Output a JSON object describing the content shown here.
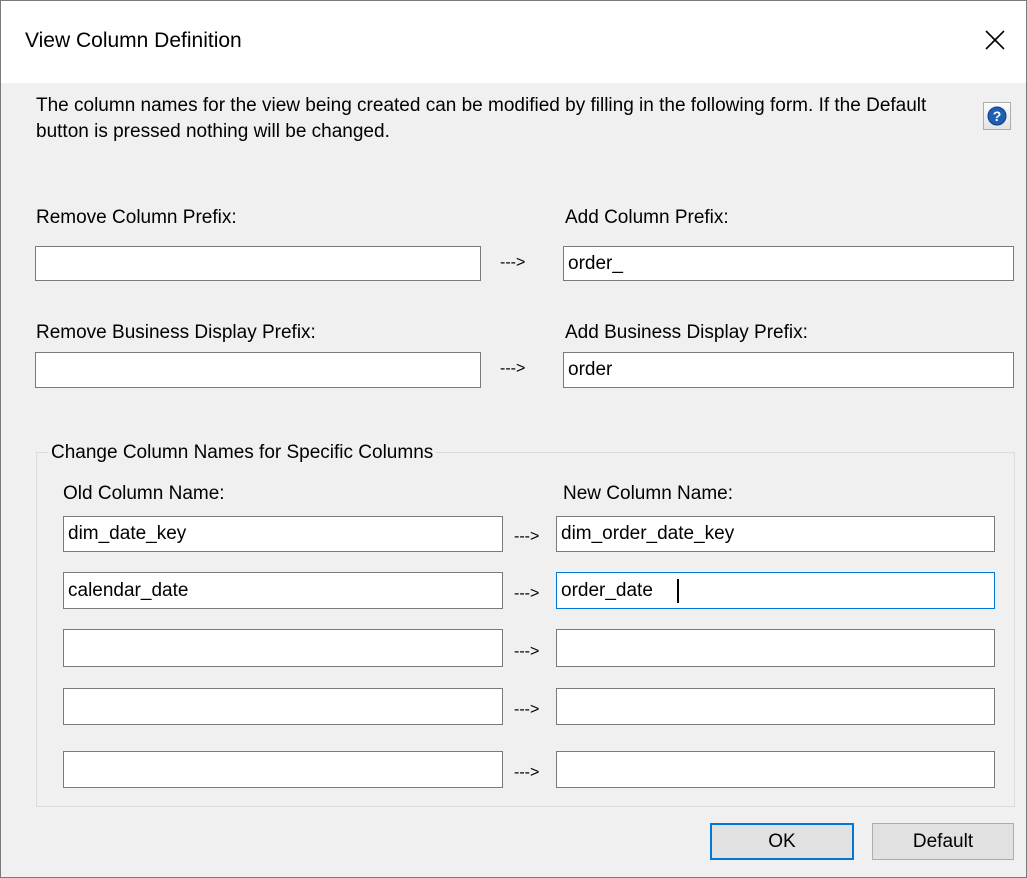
{
  "window": {
    "title": "View Column Definition",
    "close_icon": "close-icon",
    "help_icon": "help-icon"
  },
  "description": "The column names for the view being created can be modified by filling in the following form. If the Default button is pressed nothing will be changed.",
  "prefix": {
    "remove_column_label": "Remove Column Prefix:",
    "remove_column_value": "",
    "add_column_label": "Add Column Prefix:",
    "add_column_value": "order_",
    "remove_business_label": "Remove Business Display Prefix:",
    "remove_business_value": "",
    "add_business_label": "Add Business Display Prefix:",
    "add_business_value": "order",
    "arrow": "--->"
  },
  "specific": {
    "group_label": "Change Column Names for Specific Columns",
    "old_header": "Old Column Name:",
    "new_header": "New Column Name:",
    "arrow": "--->",
    "rows": [
      {
        "old": "dim_date_key",
        "new": "dim_order_date_key"
      },
      {
        "old": "calendar_date",
        "new": "order_date"
      },
      {
        "old": "",
        "new": ""
      },
      {
        "old": "",
        "new": ""
      },
      {
        "old": "",
        "new": ""
      }
    ]
  },
  "buttons": {
    "ok": "OK",
    "default": "Default"
  },
  "colors": {
    "accent": "#0078d7",
    "dialog_bg": "#f0f0f0",
    "help_icon_blue": "#1e5fb3"
  }
}
